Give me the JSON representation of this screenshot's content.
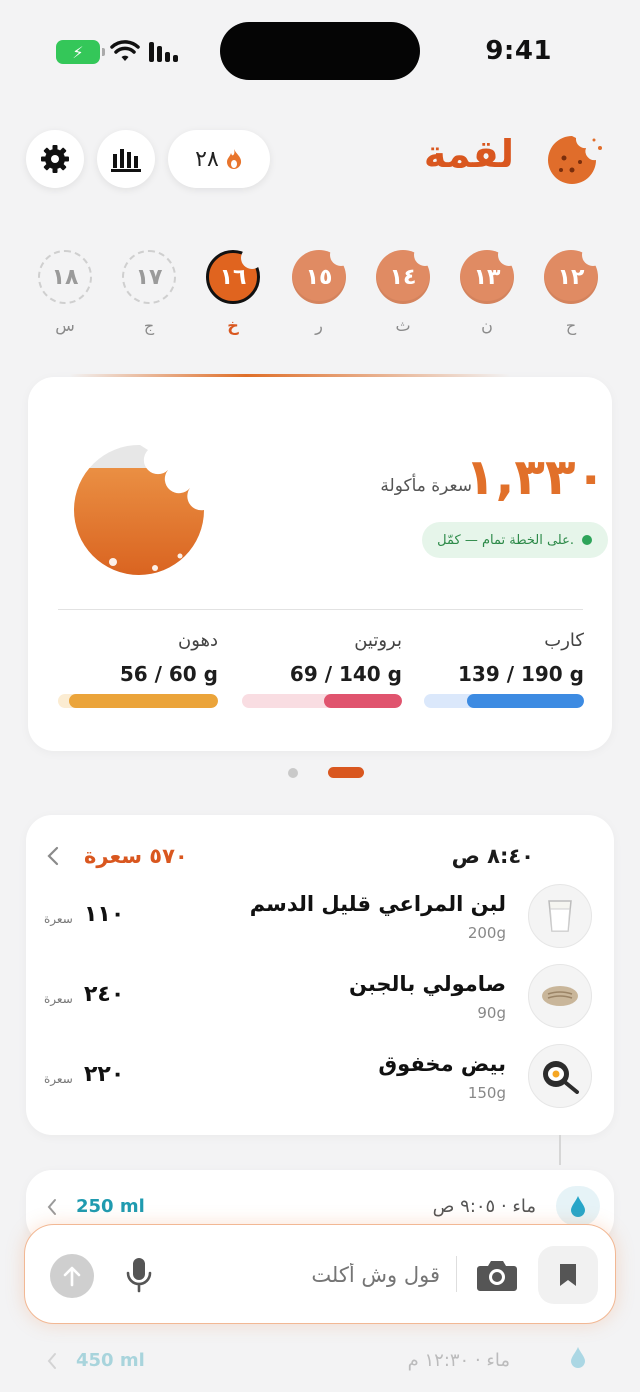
{
  "status": {
    "time": "9:41"
  },
  "header": {
    "title": "لقمة",
    "streak_count": "٢٨"
  },
  "week": [
    {
      "num": "١٢",
      "label": "ح",
      "state": "past"
    },
    {
      "num": "١٣",
      "label": "ن",
      "state": "past"
    },
    {
      "num": "١٤",
      "label": "ث",
      "state": "past"
    },
    {
      "num": "١٥",
      "label": "ر",
      "state": "past"
    },
    {
      "num": "١٦",
      "label": "خ",
      "state": "today"
    },
    {
      "num": "١٧",
      "label": "ج",
      "state": "future"
    },
    {
      "num": "١٨",
      "label": "س",
      "state": "future"
    }
  ],
  "summary": {
    "calories": "١,٣٣٠",
    "calories_label": "سعرة مأكولة",
    "status_text": "على الخطة تمام — كمّل.",
    "eaten_fraction": 0.8,
    "macros": [
      {
        "name": "كارب",
        "value": "139 / 190 g",
        "fraction": 0.73,
        "color": "#3d8be2",
        "track": "#dbe8fb"
      },
      {
        "name": "بروتين",
        "value": "69 / 140 g",
        "fraction": 0.49,
        "color": "#e0546e",
        "track": "#f9dde2"
      },
      {
        "name": "دهون",
        "value": "56 / 60 g",
        "fraction": 0.93,
        "color": "#eba43a",
        "track": "#fbecd2"
      }
    ]
  },
  "pager": {
    "pages": 2,
    "active": 1
  },
  "meal": {
    "time": "٨:٤٠ ص",
    "total": "٥٧٠ سعرة",
    "items": [
      {
        "name": "لبن المراعي قليل الدسم",
        "weight": "200g",
        "cal": "١١٠",
        "unit": "سعرة",
        "icon": "milk-glass-icon"
      },
      {
        "name": "صامولي بالجبن",
        "weight": "90g",
        "cal": "٢٤٠",
        "unit": "سعرة",
        "icon": "bread-icon"
      },
      {
        "name": "بيض مخفوق",
        "weight": "150g",
        "cal": "٢٢٠",
        "unit": "سعرة",
        "icon": "frying-pan-egg-icon"
      }
    ]
  },
  "water": [
    {
      "label": "ماء · ٩:٠٥ ص",
      "amount": "250 ml"
    },
    {
      "label": "ماء · ١٢:٣٠ م",
      "amount": "450 ml"
    }
  ],
  "input": {
    "placeholder": "قول وش أكلت"
  },
  "colors": {
    "accent": "#d9571f",
    "accent_light": "#e1702a",
    "water": "#1f9bb0"
  }
}
